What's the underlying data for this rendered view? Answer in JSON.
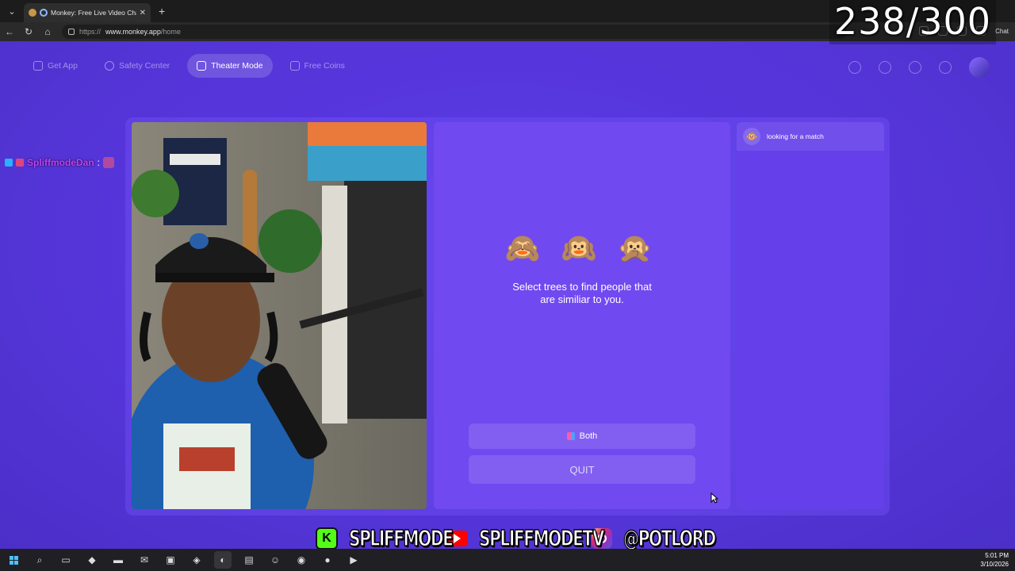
{
  "browser": {
    "tab_title": "Monkey: Free Live Video Chat",
    "url_scheme": "https://",
    "url_host": "www.monkey.app",
    "url_path": "/home",
    "chat_label": "Chat"
  },
  "overlay": {
    "counter": "238/300",
    "viewer_name": "SpliffmodeDan",
    "viewer_colon": ":",
    "socials": {
      "kick": "SPLIFFMODE",
      "youtube": "SPLIFFMODETV",
      "instagram": "@POTLORD"
    }
  },
  "nav": {
    "get_app": "Get App",
    "safety_center": "Safety Center",
    "theater_mode": "Theater Mode",
    "free_coins": "Free Coins"
  },
  "main": {
    "monkeys": "🙈 🙉 🙊",
    "prompt": "Select trees to find people that are similiar to you.",
    "gender_button": "Both",
    "quit_button": "QUIT"
  },
  "chat": {
    "status": "looking for a match"
  },
  "taskbar": {
    "time": "5:01 PM",
    "date": "3/10/2026"
  },
  "colors": {
    "page_bg": "#5b3be0",
    "center_panel": "#7149f0",
    "chat_panel": "#6540ea",
    "viewer_name": "#c040ff"
  }
}
